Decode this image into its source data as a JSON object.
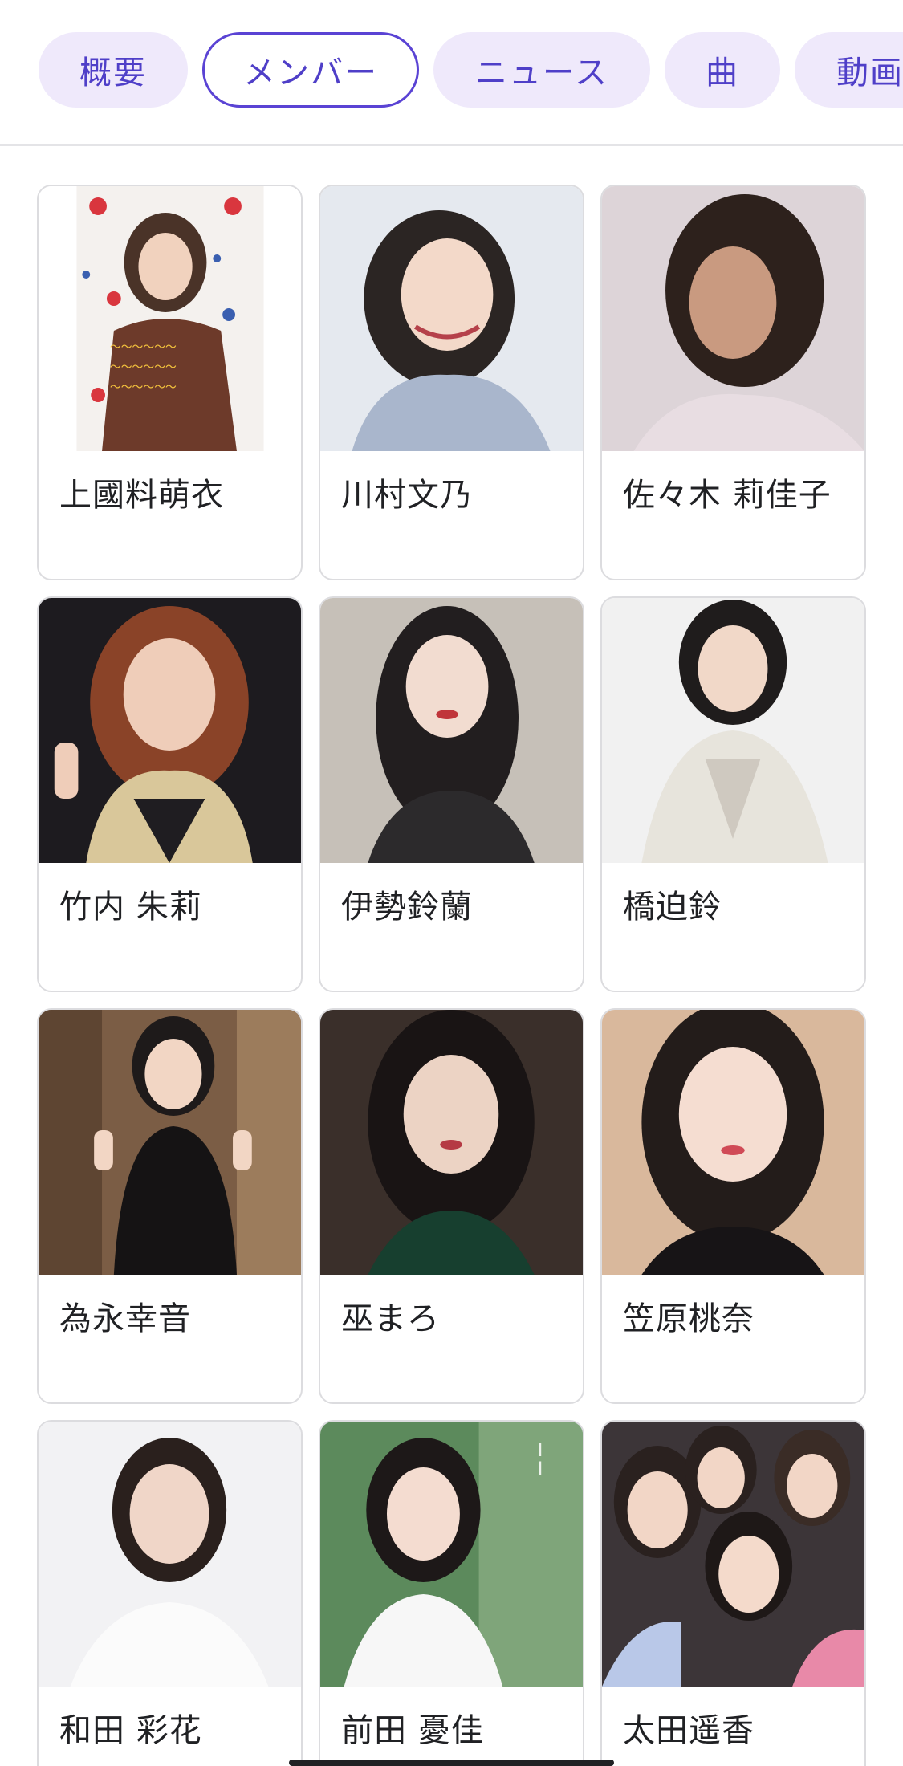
{
  "tabs": [
    {
      "label": "概要",
      "active": false
    },
    {
      "label": "メンバー",
      "active": true
    },
    {
      "label": "ニュース",
      "active": false
    },
    {
      "label": "曲",
      "active": false
    },
    {
      "label": "動画",
      "active": false
    }
  ],
  "members": [
    {
      "name": "上國料萌衣"
    },
    {
      "name": "川村文乃"
    },
    {
      "name": "佐々木 莉佳子"
    },
    {
      "name": "竹内 朱莉"
    },
    {
      "name": "伊勢鈴蘭"
    },
    {
      "name": "橋迫鈴"
    },
    {
      "name": "為永幸音"
    },
    {
      "name": "巫まろ"
    },
    {
      "name": "笠原桃奈"
    },
    {
      "name": "和田 彩花"
    },
    {
      "name": "前田 憂佳"
    },
    {
      "name": "太田遥香"
    }
  ],
  "colors": {
    "accent": "#5a43d4",
    "chip_bg": "#efe9fb",
    "chip_text": "#4f3fc8"
  }
}
